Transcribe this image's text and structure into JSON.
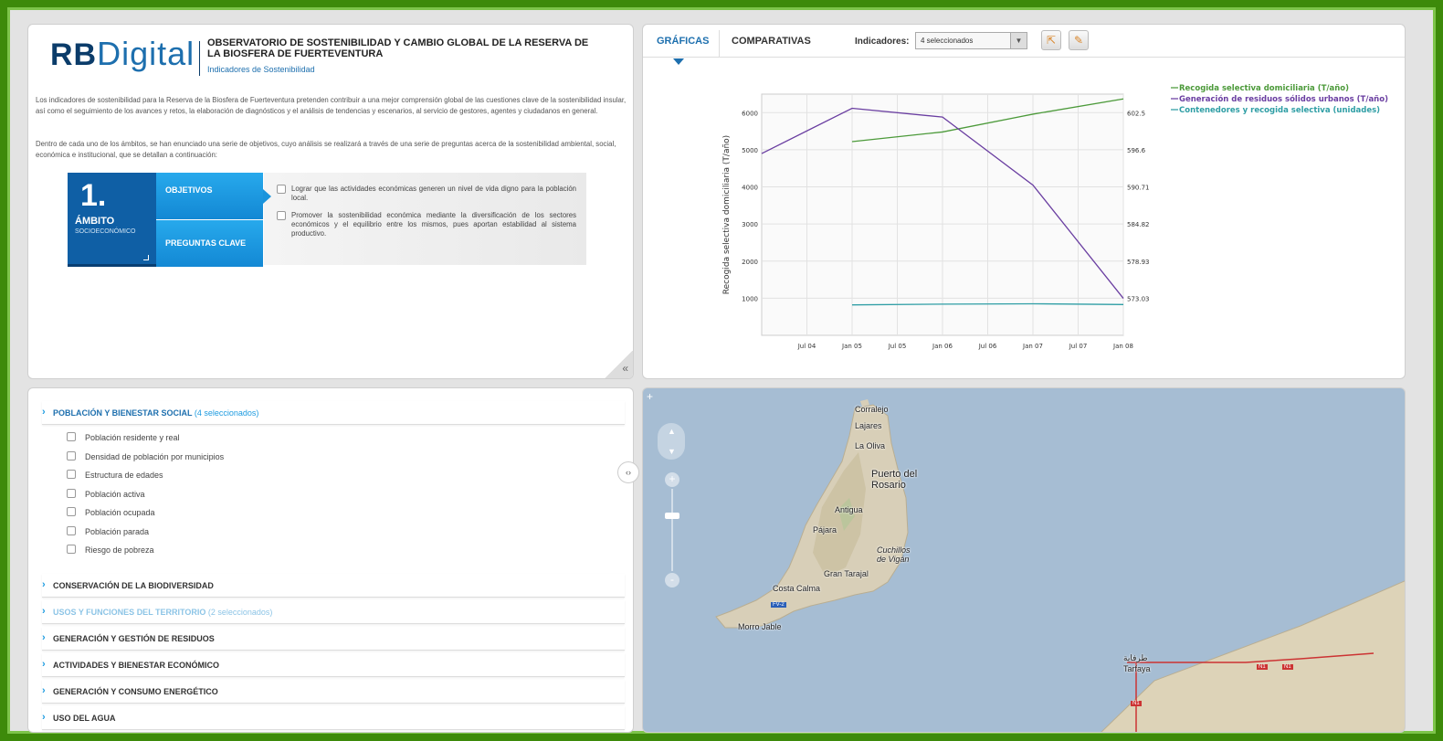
{
  "header": {
    "logo_prefix": "RB",
    "logo_text": "Digital",
    "title": "OBSERVATORIO DE SOSTENIBILIDAD Y CAMBIO GLOBAL DE LA RESERVA DE LA BIOSFERA DE FUERTEVENTURA",
    "subtitle": "Indicadores de Sostenibilidad"
  },
  "intro": {
    "p1": "Los indicadores de sostenibilidad para la Reserva de la Biosfera de Fuerteventura pretenden contribuir a una mejor comprensión global de las cuestiones clave de la sostenibilidad insular, así como el seguimiento de los avances y retos, la elaboración de diagnósticos y el análisis de tendencias y escenarios, al servicio de gestores, agentes y ciudadanos en general.",
    "p2": "Dentro de cada uno de los ámbitos, se han enunciado una serie de objetivos, cuyo análisis se realizará a través de una serie de preguntas acerca de la sostenibilidad ambiental, social, económica e institucional, que se detallan a continuación:"
  },
  "ambito": {
    "number": "1.",
    "label": "ÁMBITO",
    "sub": "SOCIOECONÓMICO",
    "tab_objetivos": "OBJETIVOS",
    "tab_preguntas": "PREGUNTAS CLAVE",
    "objectives": [
      "Lograr que las actividades económicas generen un nivel de vida digno para la población local.",
      "Promover la sostenibilidad económica mediante la diversificación de los sectores económicos y el equilibrio entre los mismos, pues aportan estabilidad al sistema productivo."
    ],
    "collapse": "«"
  },
  "chart_panel": {
    "tab_graficas": "GRÁFICAS",
    "tab_comparativas": "COMPARATIVAS",
    "indicadores_label": "Indicadores:",
    "indicadores_value": "4 seleccionados"
  },
  "chart_data": {
    "type": "line",
    "ylabel": "Recogida selectiva domiciliaria (T/año)",
    "x_ticks": [
      "Jul 04",
      "Jan 05",
      "Jul 05",
      "Jan 06",
      "Jul 06",
      "Jan 07",
      "Jul 07",
      "Jan 08"
    ],
    "x_domain": [
      "Jan 04",
      "Jan 08"
    ],
    "ylim_left": [
      0,
      6500
    ],
    "y_ticks_left": [
      1000,
      2000,
      3000,
      4000,
      5000,
      6000
    ],
    "y_ticks_right": [
      "573.03",
      "578.93",
      "584.82",
      "590.71",
      "596.6",
      "602.5"
    ],
    "legend_position": "top-right",
    "series": [
      {
        "name": "Recogida selectiva domiciliaria (T/año)",
        "color": "#4c9a3a",
        "axis": "left",
        "points": [
          [
            "Jan 05",
            5220
          ],
          [
            "Jan 06",
            5480
          ],
          [
            "Jan 07",
            5960
          ],
          [
            "Jan 08",
            6370
          ]
        ]
      },
      {
        "name": "Generación de residuos sólidos urbanos (T/año)",
        "color": "#6a3ea1",
        "axis": "right",
        "points": [
          [
            "Jan 04",
            596.0
          ],
          [
            "Jan 05",
            603.2
          ],
          [
            "Jan 06",
            601.8
          ],
          [
            "Jan 07",
            591.0
          ],
          [
            "Jan 08",
            573.0
          ]
        ]
      },
      {
        "name": "Contenedores y recogida selectiva (unidades)",
        "color": "#2f9ea5",
        "axis": "left",
        "points": [
          [
            "Jan 05",
            820
          ],
          [
            "Jan 06",
            840
          ],
          [
            "Jan 07",
            850
          ],
          [
            "Jan 08",
            830
          ]
        ]
      }
    ]
  },
  "list": {
    "sections": [
      {
        "label": "POBLACIÓN Y BIENESTAR SOCIAL",
        "count": "(4 seleccionados)"
      },
      {
        "label": "CONSERVACIÓN DE LA BIODIVERSIDAD",
        "count": ""
      },
      {
        "label": "USOS Y FUNCIONES DEL TERRITORIO",
        "count": "(2 seleccionados)"
      },
      {
        "label": "GENERACIÓN Y GESTIÓN DE RESIDUOS",
        "count": ""
      },
      {
        "label": "ACTIVIDADES Y BIENESTAR ECONÓMICO",
        "count": ""
      },
      {
        "label": "GENERACIÓN Y CONSUMO ENERGÉTICO",
        "count": ""
      },
      {
        "label": "USO DEL AGUA",
        "count": ""
      }
    ],
    "items": [
      "Población residente y real",
      "Densidad de población por municipios",
      "Estructura de edades",
      "Población activa",
      "Población ocupada",
      "Población parada",
      "Riesgo de pobreza"
    ],
    "toggle": "‹›"
  },
  "map": {
    "places": [
      "Corralejo",
      "Lajares",
      "La Oliva",
      "Puerto del Rosario",
      "Antigua",
      "Pájara",
      "Cuchillos de Vigán",
      "Gran Tarajal",
      "Costa Calma",
      "Morro Jable",
      "طرفاية",
      "Tarfaya"
    ],
    "roads": [
      "FV-2",
      "N1",
      "N1",
      "N1"
    ],
    "zoom_plus": "+",
    "zoom_minus": "-",
    "expand": "+",
    "colors": {
      "sea": "#a6bdd3",
      "land": "#d8cfb8"
    }
  }
}
